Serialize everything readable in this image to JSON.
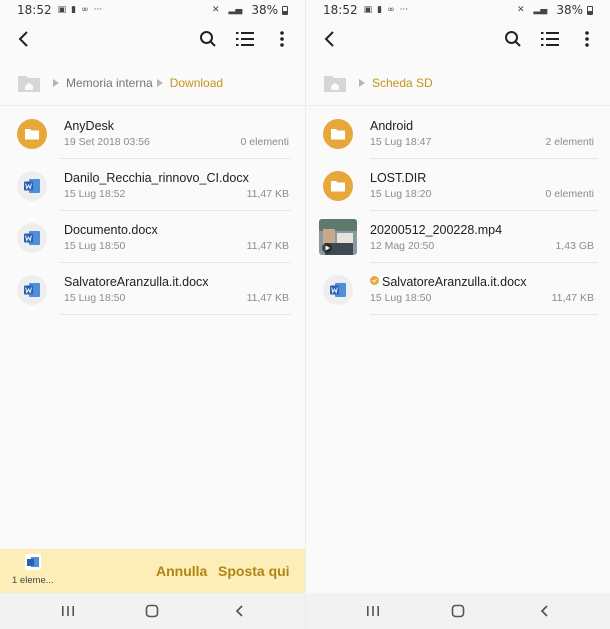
{
  "left": {
    "status": {
      "time": "18:52",
      "ellipsis": "···",
      "battery": "38%"
    },
    "breadcrumb": [
      {
        "label": "Memoria interna",
        "active": false
      },
      {
        "label": "Download",
        "active": true
      }
    ],
    "items": [
      {
        "icon": "folder-icon",
        "name": "AnyDesk",
        "date": "19 Set 2018 03:56",
        "meta": "0 elementi"
      },
      {
        "icon": "word-doc-icon",
        "name": "Danilo_Recchia_rinnovo_CI.docx",
        "date": "15 Lug 18:52",
        "meta": "11,47 KB"
      },
      {
        "icon": "word-doc-icon",
        "name": "Documento.docx",
        "date": "15 Lug 18:50",
        "meta": "11,47 KB"
      },
      {
        "icon": "word-doc-icon",
        "name": "SalvatoreAranzulla.it.docx",
        "date": "15 Lug 18:50",
        "meta": "11,47 KB"
      }
    ],
    "movebar": {
      "count": "1 eleme...",
      "cancel_label": "Annulla",
      "move_label": "Sposta qui"
    }
  },
  "right": {
    "status": {
      "time": "18:52",
      "ellipsis": "···",
      "battery": "38%"
    },
    "breadcrumb": [
      {
        "label": "Scheda SD",
        "active": true
      }
    ],
    "items": [
      {
        "icon": "folder-icon",
        "name": "Android",
        "date": "15 Lug 18:47",
        "meta": "2 elementi"
      },
      {
        "icon": "folder-icon",
        "name": "LOST.DIR",
        "date": "15 Lug 18:20",
        "meta": "0 elementi"
      },
      {
        "icon": "video-thumbnail-icon",
        "name": "20200512_200228.mp4",
        "date": "12 Mag 20:50",
        "meta": "1,43 GB"
      },
      {
        "icon": "word-doc-icon",
        "name": "SalvatoreAranzulla.it.docx",
        "date": "15 Lug 18:50",
        "meta": "11,47 KB",
        "badge": "moved-check-icon"
      }
    ]
  },
  "colors": {
    "accent": "#c49418",
    "folder": "#e8a73a",
    "word": "#2b5fb4",
    "movebar_bg": "#fdeeb8",
    "movebar_text": "#b18414"
  }
}
